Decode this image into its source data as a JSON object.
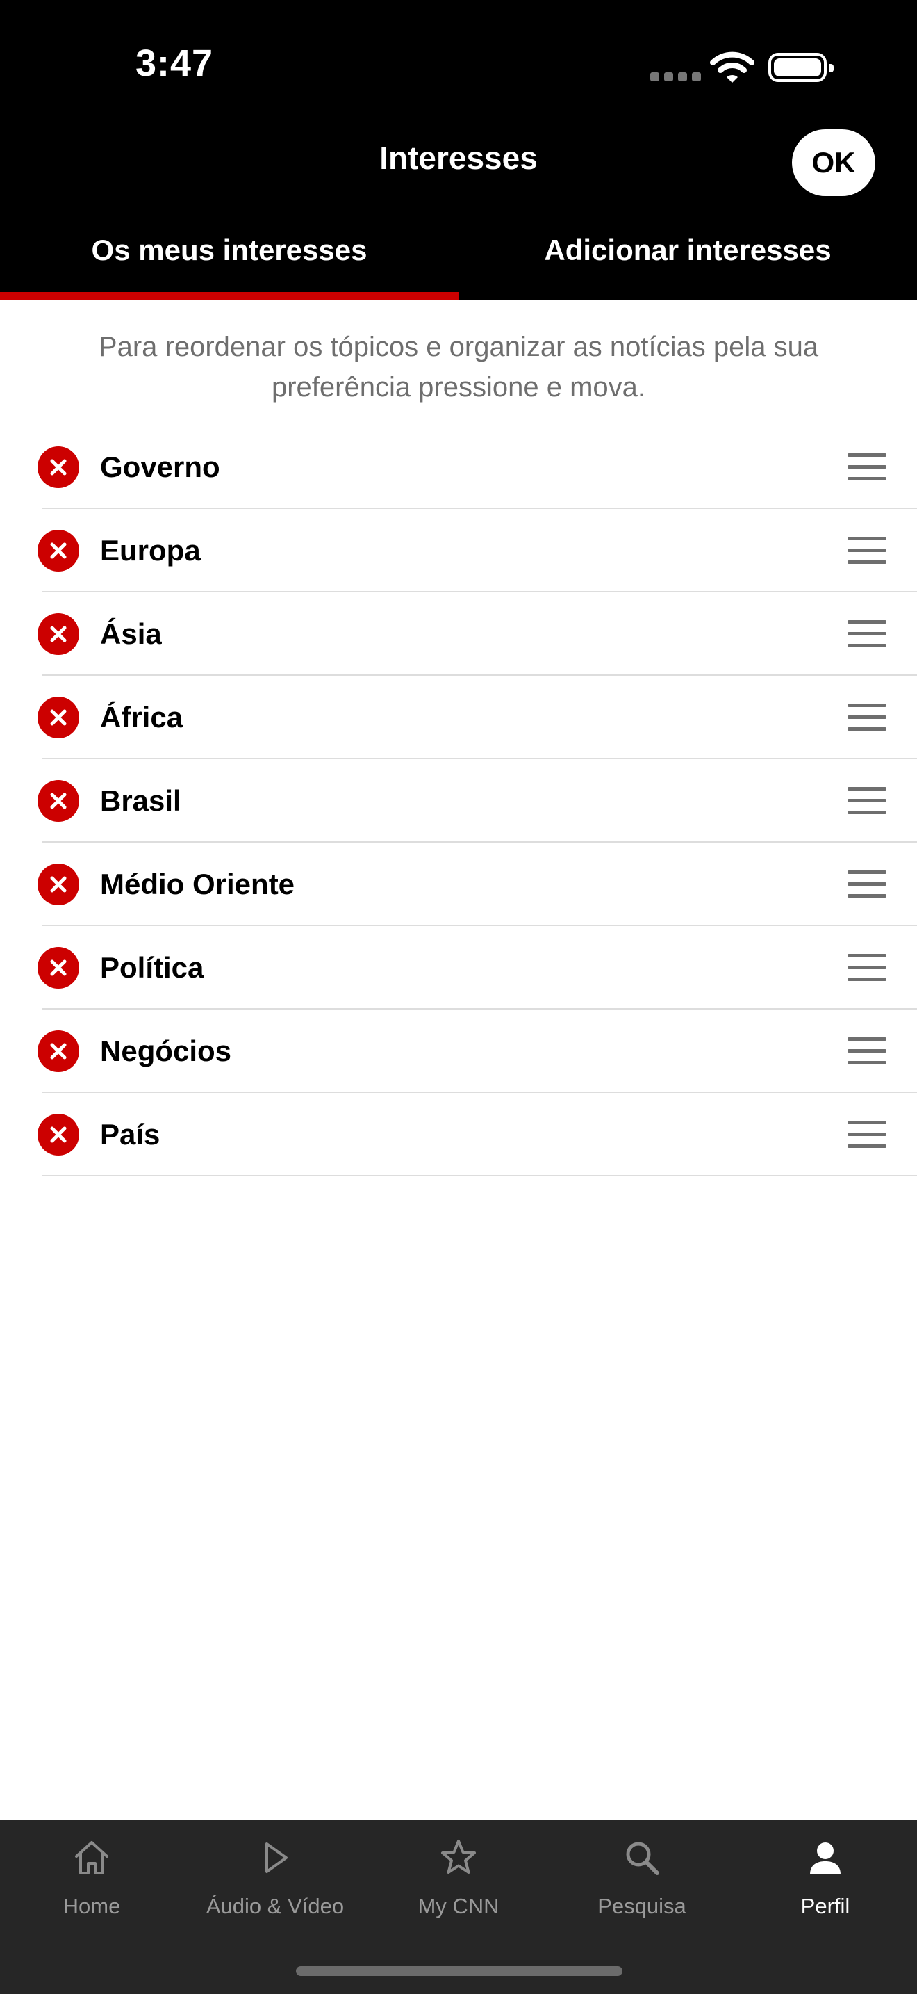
{
  "status_bar": {
    "time": "3:47"
  },
  "header": {
    "title": "Interesses",
    "ok_label": "OK"
  },
  "tabs": [
    {
      "label": "Os meus interesses",
      "selected": true
    },
    {
      "label": "Adicionar interesses",
      "selected": false
    }
  ],
  "instructions": "Para reordenar os tópicos e organizar as notícias pela sua preferência pressione e mova.",
  "interests": [
    {
      "label": "Governo"
    },
    {
      "label": "Europa"
    },
    {
      "label": "Ásia"
    },
    {
      "label": "África"
    },
    {
      "label": "Brasil"
    },
    {
      "label": "Médio Oriente"
    },
    {
      "label": "Política"
    },
    {
      "label": "Negócios"
    },
    {
      "label": "País"
    }
  ],
  "tabbar": {
    "items": [
      {
        "label": "Home",
        "icon": "home-icon"
      },
      {
        "label": "Áudio & Vídeo",
        "icon": "play-icon"
      },
      {
        "label": "My CNN",
        "icon": "star-icon"
      },
      {
        "label": "Pesquisa",
        "icon": "search-icon"
      },
      {
        "label": "Perfil",
        "icon": "person-icon",
        "active": true
      }
    ]
  },
  "colors": {
    "accent": "#cc0000",
    "header_bg": "#000000",
    "tabbar_bg": "#262626",
    "muted_text": "#6e6e6e"
  }
}
